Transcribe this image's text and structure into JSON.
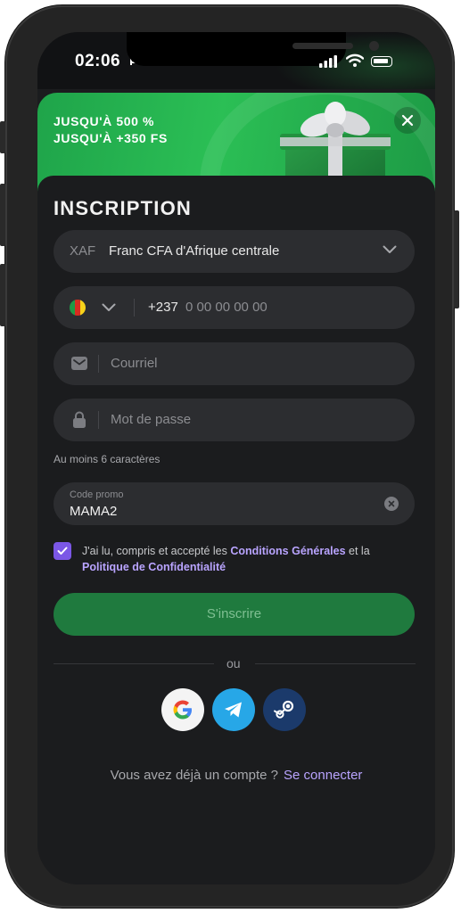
{
  "status_bar": {
    "time": "02:06"
  },
  "banner": {
    "line1": "JUSQU'À 500 %",
    "line2": "JUSQU'À +350 FS"
  },
  "form": {
    "title": "INSCRIPTION",
    "currency": {
      "code": "XAF",
      "name": "Franc CFA d'Afrique centrale"
    },
    "phone": {
      "prefix": "+237",
      "placeholder": "0 00 00 00 00"
    },
    "email_placeholder": "Courriel",
    "password_placeholder": "Mot de passe",
    "password_hint": "Au moins 6 caractères",
    "promo": {
      "label": "Code promo",
      "value": "MAMA2"
    },
    "terms": {
      "checked": true,
      "text_before": "J'ai lu, compris et accepté les ",
      "link1": "Conditions Générales",
      "text_middle": " et la",
      "link2": "Politique de Confidentialité"
    },
    "submit_label": "S'inscrire",
    "or_label": "ou",
    "social": [
      "google-icon",
      "telegram-icon",
      "steam-icon"
    ],
    "login_prompt": "Vous avez déjà un compte ?",
    "login_link": "Se connecter"
  },
  "colors": {
    "banner_green": "#2bbf55",
    "submit_green": "#1f7a3e",
    "accent_purple": "#7b57e6",
    "link_purple": "#b9a4ff",
    "telegram_blue": "#27a7e7",
    "steam_navy": "#1b3a6b"
  }
}
